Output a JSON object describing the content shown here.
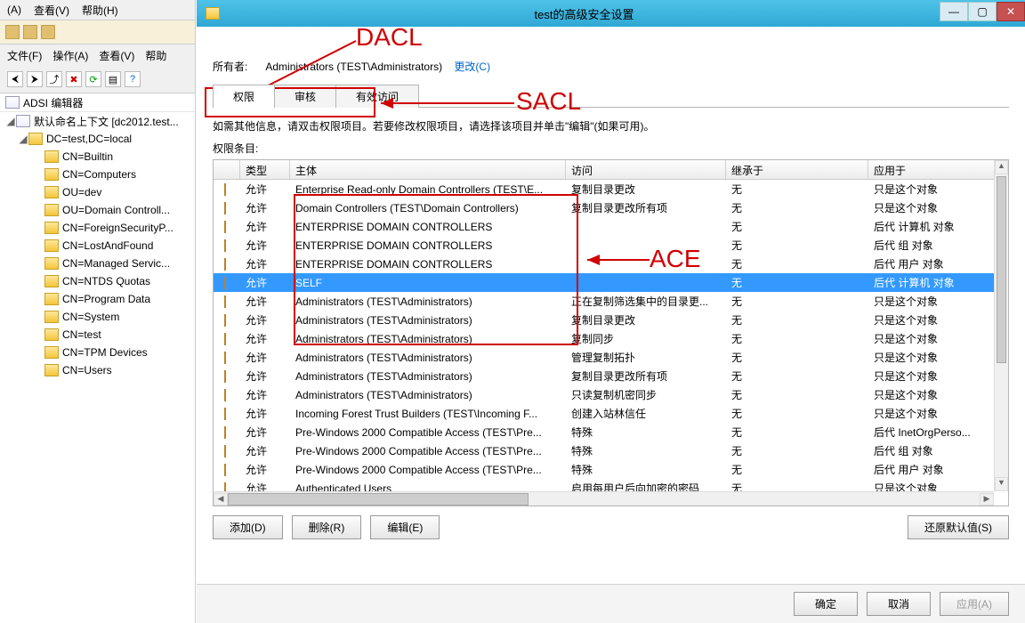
{
  "bg": {
    "menu": {
      "a": "(A)",
      "view": "查看(V)",
      "help": "帮助(H)"
    },
    "label": {
      "file": "文件(F)",
      "action": "操作(A)",
      "view": "查看(V)",
      "help": "帮助"
    },
    "tree_title": "ADSI 编辑器",
    "root": "默认命名上下文 [dc2012.test...",
    "dc": "DC=test,DC=local",
    "nodes": [
      "CN=Builtin",
      "CN=Computers",
      "OU=dev",
      "OU=Domain Controll...",
      "CN=ForeignSecurityP...",
      "CN=LostAndFound",
      "CN=Managed Servic...",
      "CN=NTDS Quotas",
      "CN=Program Data",
      "CN=System",
      "CN=test",
      "CN=TPM Devices",
      "CN=Users"
    ]
  },
  "dialog": {
    "title": "test的高级安全设置",
    "owner_label": "所有者:",
    "owner_value": "Administrators (TEST\\Administrators)",
    "change_link": "更改(C)",
    "tabs": {
      "perm": "权限",
      "audit": "审核",
      "effective": "有效访问"
    },
    "info": "如需其他信息，请双击权限项目。若要修改权限项目，请选择该项目并单击\"编辑\"(如果可用)。",
    "list_label": "权限条目:",
    "headers": {
      "type": "类型",
      "principal": "主体",
      "access": "访问",
      "inherit": "继承于",
      "apply": "应用于"
    },
    "rows": [
      {
        "type": "允许",
        "principal": "Enterprise Read-only Domain Controllers (TEST\\E...",
        "access": "复制目录更改",
        "inherit": "无",
        "apply": "只是这个对象"
      },
      {
        "type": "允许",
        "principal": "Domain Controllers (TEST\\Domain Controllers)",
        "access": "复制目录更改所有项",
        "inherit": "无",
        "apply": "只是这个对象"
      },
      {
        "type": "允许",
        "principal": "ENTERPRISE DOMAIN CONTROLLERS",
        "access": "",
        "inherit": "无",
        "apply": "后代 计算机 对象"
      },
      {
        "type": "允许",
        "principal": "ENTERPRISE DOMAIN CONTROLLERS",
        "access": "",
        "inherit": "无",
        "apply": "后代 组 对象"
      },
      {
        "type": "允许",
        "principal": "ENTERPRISE DOMAIN CONTROLLERS",
        "access": "",
        "inherit": "无",
        "apply": "后代 用户 对象"
      },
      {
        "type": "允许",
        "principal": "SELF",
        "access": "",
        "inherit": "无",
        "apply": "后代 计算机 对象",
        "selected": true
      },
      {
        "type": "允许",
        "principal": "Administrators (TEST\\Administrators)",
        "access": "正在复制筛选集中的目录更...",
        "inherit": "无",
        "apply": "只是这个对象"
      },
      {
        "type": "允许",
        "principal": "Administrators (TEST\\Administrators)",
        "access": "复制目录更改",
        "inherit": "无",
        "apply": "只是这个对象"
      },
      {
        "type": "允许",
        "principal": "Administrators (TEST\\Administrators)",
        "access": "复制同步",
        "inherit": "无",
        "apply": "只是这个对象"
      },
      {
        "type": "允许",
        "principal": "Administrators (TEST\\Administrators)",
        "access": "管理复制拓扑",
        "inherit": "无",
        "apply": "只是这个对象"
      },
      {
        "type": "允许",
        "principal": "Administrators (TEST\\Administrators)",
        "access": "复制目录更改所有项",
        "inherit": "无",
        "apply": "只是这个对象"
      },
      {
        "type": "允许",
        "principal": "Administrators (TEST\\Administrators)",
        "access": "只读复制机密同步",
        "inherit": "无",
        "apply": "只是这个对象"
      },
      {
        "type": "允许",
        "principal": "Incoming Forest Trust Builders (TEST\\Incoming F...",
        "access": "创建入站林信任",
        "inherit": "无",
        "apply": "只是这个对象"
      },
      {
        "type": "允许",
        "principal": "Pre-Windows 2000 Compatible Access (TEST\\Pre...",
        "access": "特殊",
        "inherit": "无",
        "apply": "后代 InetOrgPerso..."
      },
      {
        "type": "允许",
        "principal": "Pre-Windows 2000 Compatible Access (TEST\\Pre...",
        "access": "特殊",
        "inherit": "无",
        "apply": "后代 组 对象"
      },
      {
        "type": "允许",
        "principal": "Pre-Windows 2000 Compatible Access (TEST\\Pre...",
        "access": "特殊",
        "inherit": "无",
        "apply": "后代 用户 对象"
      },
      {
        "type": "允许",
        "principal": "Authenticated Users",
        "access": "启用每用户后向加密的密码",
        "inherit": "无",
        "apply": "只是这个对象"
      }
    ],
    "btn_add": "添加(D)",
    "btn_remove": "删除(R)",
    "btn_edit": "编辑(E)",
    "btn_restore": "还原默认值(S)",
    "btn_ok": "确定",
    "btn_cancel": "取消",
    "btn_apply": "应用(A)"
  },
  "anno": {
    "dacl": "DACL",
    "sacl": "SACL",
    "ace": "ACE"
  }
}
